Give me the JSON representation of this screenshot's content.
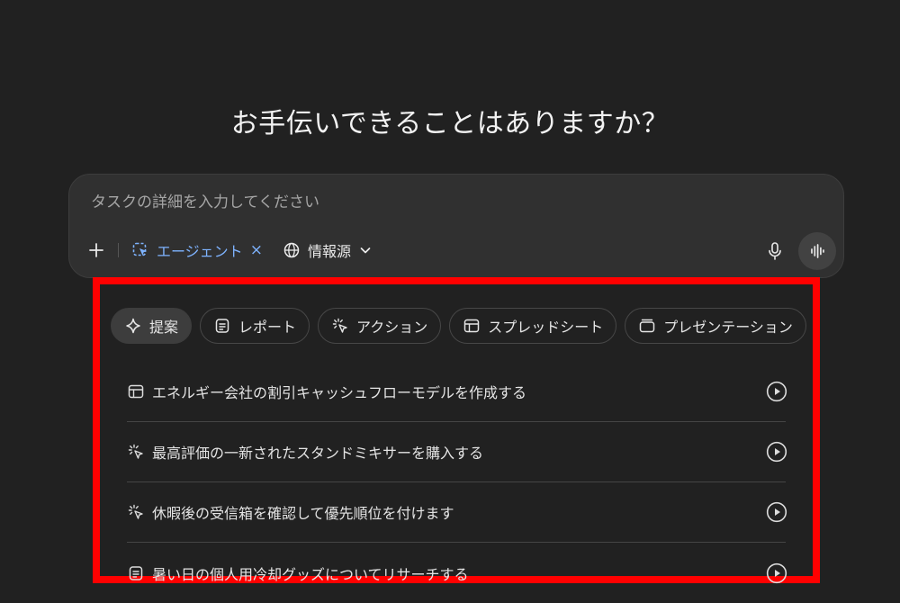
{
  "heading": "お手伝いできることはありますか？",
  "composer": {
    "placeholder": "タスクの詳細を入力してください",
    "agent_label": "エージェント",
    "agent_remove": "×",
    "sources_label": "情報源"
  },
  "tabs": [
    {
      "label": "提案",
      "icon": "sparkle-icon",
      "active": true
    },
    {
      "label": "レポート",
      "icon": "document-icon"
    },
    {
      "label": "アクション",
      "icon": "cursor-click-icon"
    },
    {
      "label": "スプレッドシート",
      "icon": "table-icon"
    },
    {
      "label": "プレゼンテーション",
      "icon": "slides-icon"
    }
  ],
  "suggestions": [
    {
      "label": "エネルギー会社の割引キャッシュフローモデルを作成する",
      "icon": "table-icon"
    },
    {
      "label": "最高評価の一新されたスタンドミキサーを購入する",
      "icon": "cursor-click-icon"
    },
    {
      "label": "休暇後の受信箱を確認して優先順位を付けます",
      "icon": "cursor-click-icon"
    },
    {
      "label": "暑い日の個人用冷却グッズについてリサーチする",
      "icon": "document-icon"
    }
  ],
  "colors": {
    "background": "#212121",
    "composer": "#303030",
    "accent": "#7eb3ff",
    "highlight_border": "#ff0000"
  }
}
